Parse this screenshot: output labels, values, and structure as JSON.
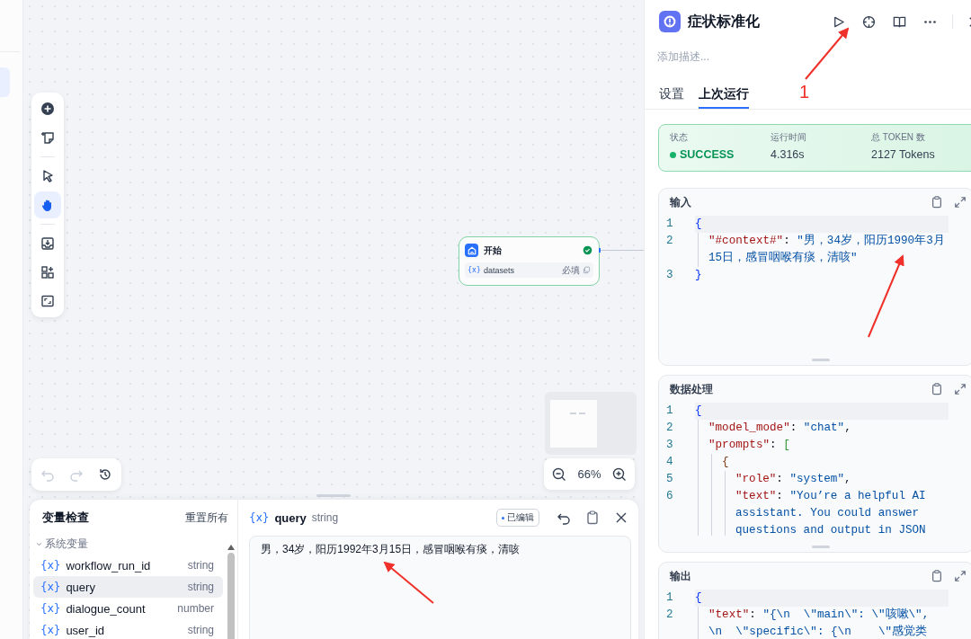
{
  "canvas": {
    "tool_groups": [
      [
        {
          "kind": "add",
          "selected": false
        },
        {
          "kind": "note",
          "selected": false
        }
      ],
      [
        {
          "kind": "pointer",
          "selected": false
        },
        {
          "kind": "hand",
          "selected": true
        }
      ],
      [
        {
          "kind": "export",
          "selected": false
        },
        {
          "kind": "layout",
          "selected": false
        },
        {
          "kind": "fullscreen",
          "selected": false
        }
      ]
    ],
    "history_tools": [
      {
        "kind": "undo",
        "disabled": true
      },
      {
        "kind": "redo",
        "disabled": true
      },
      {
        "kind": "history",
        "disabled": false
      }
    ],
    "node": {
      "title": "开始",
      "succeeded": true,
      "variables": [
        {
          "prefix": "{x}",
          "name": "datasets",
          "required_label": "必填"
        }
      ]
    },
    "zoom": {
      "value": "66%"
    }
  },
  "inspector": {
    "title": "变量检查",
    "reset": "重置所有",
    "groups": [
      {
        "label": "系统变量",
        "expanded": true,
        "items": [
          {
            "prefix": "{x}",
            "name": "workflow_run_id",
            "type": "string",
            "selected": false
          },
          {
            "prefix": "{x}",
            "name": "query",
            "type": "string",
            "selected": true
          },
          {
            "prefix": "{x}",
            "name": "dialogue_count",
            "type": "number",
            "selected": false
          },
          {
            "prefix": "{x}",
            "name": "user_id",
            "type": "string",
            "selected": false
          }
        ]
      }
    ],
    "detail": {
      "prefix": "{x}",
      "name": "query",
      "type": "string",
      "badge": "已编辑",
      "value": "男，34岁，阳历1992年3月15日，感冒咽喉有痰，清咳"
    }
  },
  "panel": {
    "title": "症状标准化",
    "description": {
      "placeholder": "添加描述..."
    },
    "actions": [
      {
        "kind": "run"
      },
      {
        "kind": "locate"
      },
      {
        "kind": "book"
      },
      {
        "kind": "more"
      },
      {
        "kind": "close"
      }
    ],
    "tabs": [
      {
        "label": "设置",
        "selected": false
      },
      {
        "label": "上次运行",
        "selected": true
      }
    ],
    "stats": [
      {
        "label": "状态",
        "value": "SUCCESS",
        "kind": "status"
      },
      {
        "label": "运行时间",
        "value": "4.316s",
        "kind": "plain"
      },
      {
        "label": "总 TOKEN 数",
        "value": "2127 Tokens",
        "kind": "plain"
      }
    ],
    "sections": [
      {
        "title": "输入",
        "resizable": true,
        "lines": [
          {
            "number": "1",
            "tokens": [
              {
                "kind": "brace1",
                "text": "{"
              }
            ],
            "children": [
              {
                "number": "2",
                "tokens": [
                  {
                    "kind": "key",
                    "text": "\"#context#\""
                  },
                  {
                    "kind": "punct",
                    "text": ": "
                  },
                  {
                    "kind": "str",
                    "text": "\"男，34岁，阳历1990年3月15日，感冒咽喉有痰，清咳\""
                  }
                ]
              }
            ]
          },
          {
            "number": "3",
            "tokens": [
              {
                "kind": "brace1",
                "text": "}"
              }
            ]
          }
        ]
      },
      {
        "title": "数据处理",
        "resizable": true,
        "lines": [
          {
            "number": "1",
            "tokens": [
              {
                "kind": "brace1",
                "text": "{"
              }
            ],
            "children": [
              {
                "number": "2",
                "tokens": [
                  {
                    "kind": "key",
                    "text": "\"model_mode\""
                  },
                  {
                    "kind": "punct",
                    "text": ": "
                  },
                  {
                    "kind": "str",
                    "text": "\"chat\""
                  },
                  {
                    "kind": "punct",
                    "text": ","
                  }
                ]
              },
              {
                "number": "3",
                "tokens": [
                  {
                    "kind": "key",
                    "text": "\"prompts\""
                  },
                  {
                    "kind": "punct",
                    "text": ": "
                  },
                  {
                    "kind": "brace2",
                    "text": "["
                  }
                ],
                "children": [
                  {
                    "number": "4",
                    "tokens": [
                      {
                        "kind": "brace3",
                        "text": "{"
                      }
                    ],
                    "children": [
                      {
                        "number": "5",
                        "tokens": [
                          {
                            "kind": "key",
                            "text": "\"role\""
                          },
                          {
                            "kind": "punct",
                            "text": ": "
                          },
                          {
                            "kind": "str",
                            "text": "\"system\""
                          },
                          {
                            "kind": "punct",
                            "text": ","
                          }
                        ]
                      },
                      {
                        "number": "6",
                        "tokens": [
                          {
                            "kind": "key",
                            "text": "\"text\""
                          },
                          {
                            "kind": "punct",
                            "text": ": "
                          },
                          {
                            "kind": "str",
                            "text": "\"You’re a helpful AI assistant. You could answer questions and output in JSON"
                          }
                        ]
                      }
                    ]
                  }
                ]
              }
            ]
          }
        ]
      },
      {
        "title": "输出",
        "lines": [
          {
            "number": "1",
            "tokens": [
              {
                "kind": "brace1",
                "text": "{"
              }
            ],
            "children": [
              {
                "number": "2",
                "tokens": [
                  {
                    "kind": "key",
                    "text": "\"text\""
                  },
                  {
                    "kind": "punct",
                    "text": ": "
                  },
                  {
                    "kind": "str",
                    "text": "\"{\\n  \\\"main\\\": \\\"咳嗽\\\", \\n  \\\"specific\\\": {\\n    \\\"感觉类"
                  }
                ]
              }
            ]
          }
        ]
      }
    ]
  },
  "annotation": {
    "label": "1"
  }
}
